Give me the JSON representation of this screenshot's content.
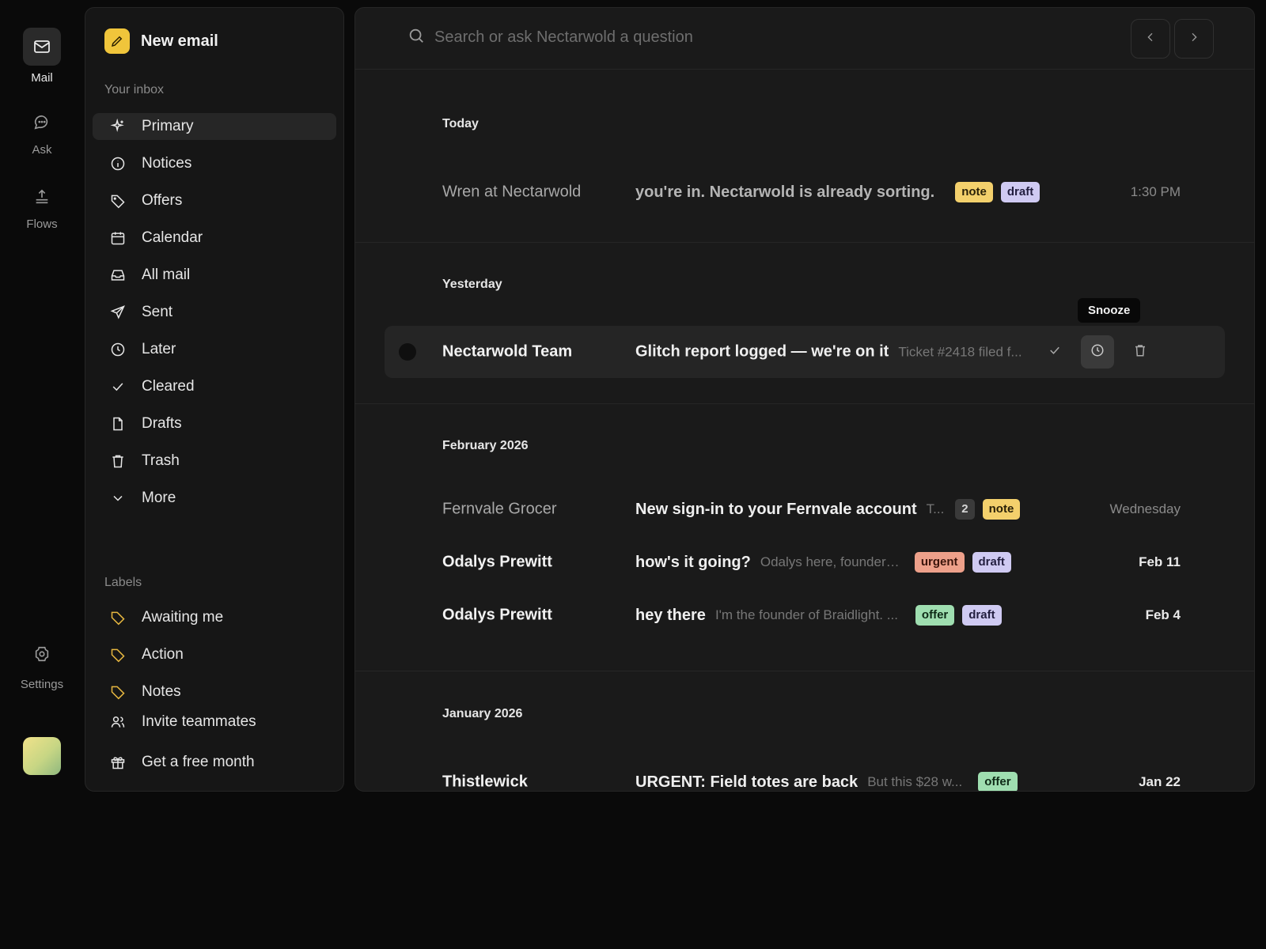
{
  "rail": {
    "mail_label": "Mail",
    "ask_label": "Ask",
    "flows_label": "Flows",
    "settings_label": "Settings"
  },
  "sidebar": {
    "new_email_label": "New email",
    "inbox_heading": "Your inbox",
    "nav": [
      {
        "label": "Primary",
        "icon": "sparkle-icon",
        "active": true
      },
      {
        "label": "Notices",
        "icon": "info-icon"
      },
      {
        "label": "Offers",
        "icon": "tag-icon"
      },
      {
        "label": "Calendar",
        "icon": "calendar-icon"
      },
      {
        "label": "All mail",
        "icon": "inbox-icon"
      },
      {
        "label": "Sent",
        "icon": "send-icon"
      },
      {
        "label": "Later",
        "icon": "clock-icon"
      },
      {
        "label": "Cleared",
        "icon": "check-icon"
      },
      {
        "label": "Drafts",
        "icon": "document-icon"
      },
      {
        "label": "Trash",
        "icon": "trash-icon"
      },
      {
        "label": "More",
        "icon": "chevron-down-icon"
      }
    ],
    "labels_heading": "Labels",
    "labels": [
      {
        "label": "Awaiting me",
        "icon": "tag-icon"
      },
      {
        "label": "Action",
        "icon": "tag-icon"
      },
      {
        "label": "Notes",
        "icon": "tag-icon"
      }
    ],
    "footer": [
      {
        "label": "Invite teammates",
        "icon": "users-icon"
      },
      {
        "label": "Get a free month",
        "icon": "gift-icon"
      }
    ]
  },
  "search": {
    "placeholder": "Search or ask Nectarwold a question"
  },
  "groups": {
    "today": "Today",
    "yesterday": "Yesterday",
    "feb": "February 2026",
    "jan": "January 2026"
  },
  "emails": [
    {
      "sender": "Wren at Nectarwold",
      "subject": "you're in. Nectarwold is already sorting.",
      "preview": "",
      "tags": [
        "note",
        "draft"
      ],
      "date": "1:30 PM",
      "read": true
    },
    {
      "sender": "Nectarwold Team",
      "subject": "Glitch report logged — we're on it",
      "preview": "Ticket #2418 filed f...",
      "tags": [],
      "date": "",
      "read": false
    },
    {
      "sender": "Fernvale Grocer",
      "subject": "New sign-in to your Fernvale account",
      "preview": "T...",
      "tags": [
        "2",
        "note"
      ],
      "date": "Wednesday",
      "read": true
    },
    {
      "sender": "Odalys Prewitt",
      "subject": "how's it going?",
      "preview": "Odalys here, founder ...",
      "tags": [
        "urgent",
        "draft"
      ],
      "date": "Feb 11",
      "read": false
    },
    {
      "sender": "Odalys Prewitt",
      "subject": "hey there",
      "preview": "I'm the founder of Braidlight. ...",
      "tags": [
        "offer",
        "draft"
      ],
      "date": "Feb 4",
      "read": false
    },
    {
      "sender": "Thistlewick",
      "subject": "URGENT: Field totes are back",
      "preview": "But this $28 w...",
      "tags": [
        "offer"
      ],
      "date": "Jan 22",
      "read": false
    }
  ],
  "tooltip": "Snooze",
  "colors": {
    "accent": "#f0c53b",
    "note": "#f3d06c",
    "draft": "#cfcaf2",
    "urgent": "#eda08a",
    "offer": "#9fdeb0"
  }
}
